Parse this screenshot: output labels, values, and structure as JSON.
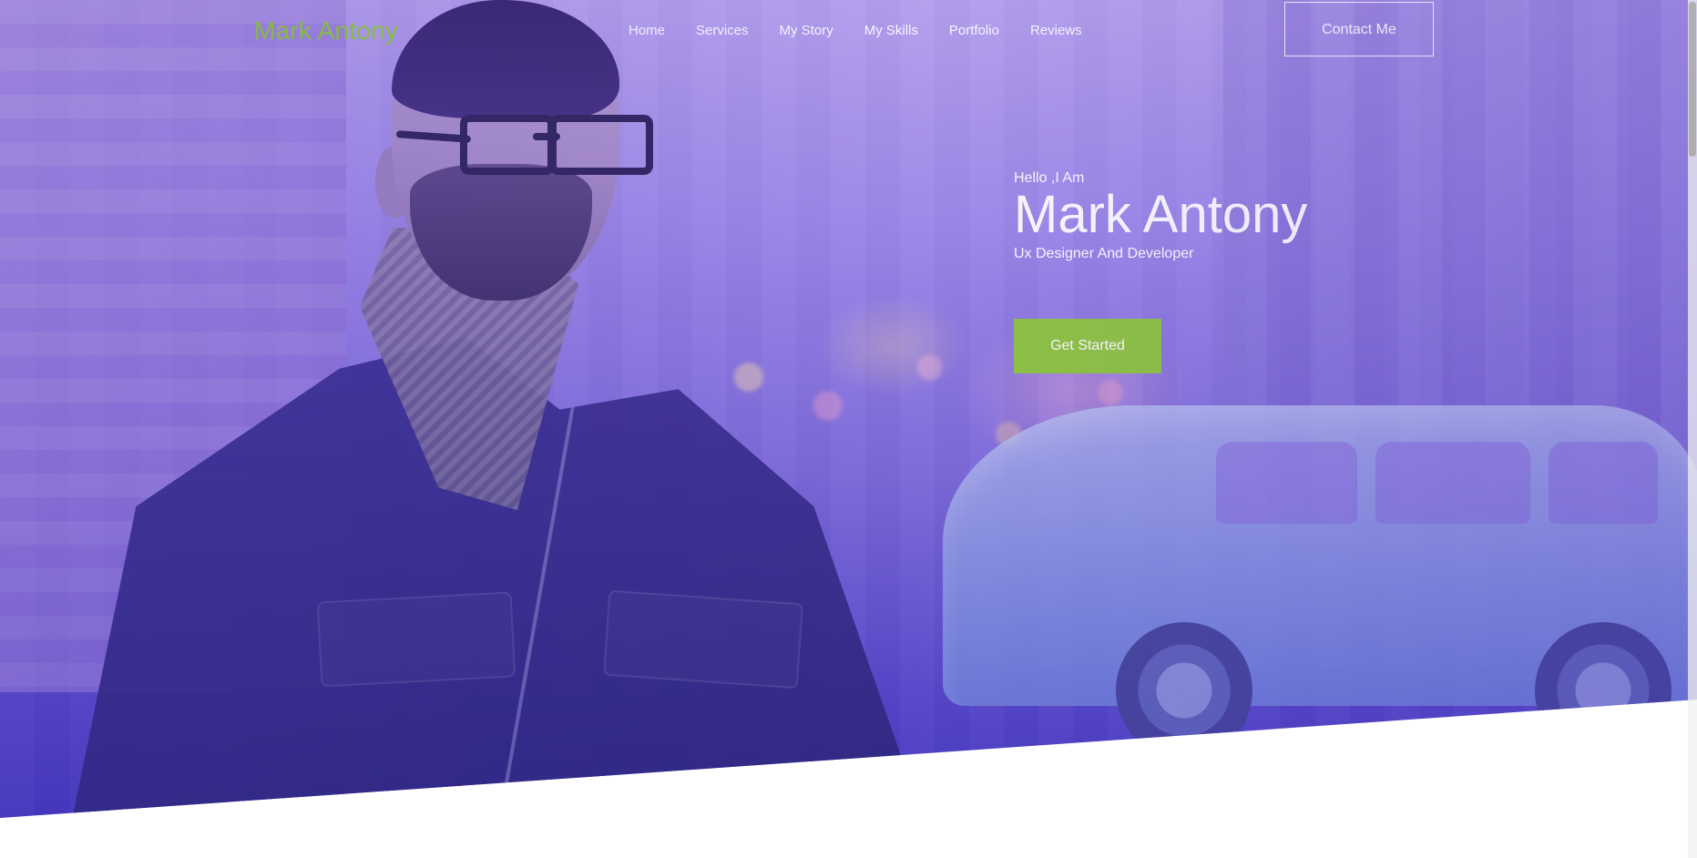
{
  "header": {
    "brand": "Mark Antony",
    "nav": [
      "Home",
      "Services",
      "My Story",
      "My Skills",
      "Portfolio",
      "Reviews"
    ],
    "contact_label": "Contact Me"
  },
  "hero": {
    "greeting": "Hello ,I Am",
    "name": "Mark Antony",
    "role": "Ux Designer And Developer",
    "cta_label": "Get Started"
  },
  "colors": {
    "brand": "#8fd12d",
    "accent": "#8fc63d",
    "hero_overlay": "#6e5be0"
  }
}
